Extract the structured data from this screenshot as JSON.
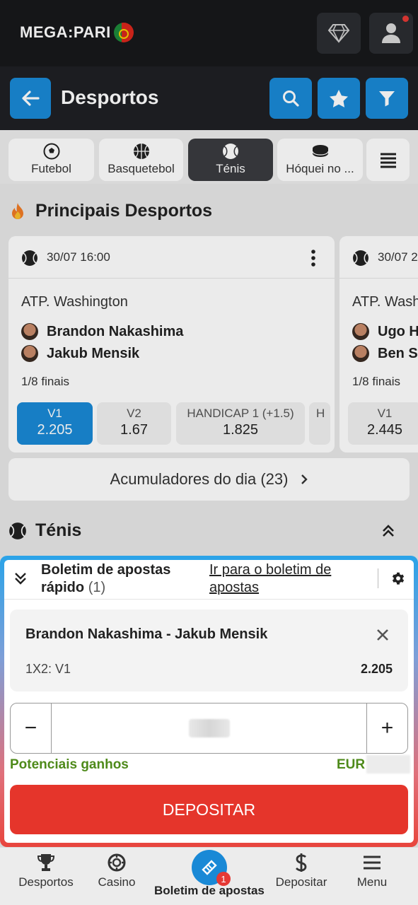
{
  "header": {
    "logo_text": "MEGA:PARI",
    "title": "Desportos"
  },
  "tabs": [
    {
      "label": "Futebol",
      "icon": "soccer-ball-icon",
      "active": false
    },
    {
      "label": "Basquetebol",
      "icon": "basketball-icon",
      "active": false
    },
    {
      "label": "Ténis",
      "icon": "tennis-ball-icon",
      "active": true
    },
    {
      "label": "Hóquei no ...",
      "icon": "hockey-puck-icon",
      "active": false
    }
  ],
  "main": {
    "top_section_title": "Principais Desportos",
    "cards": [
      {
        "datetime": "30/07 16:00",
        "league": "ATP. Washington",
        "player1": "Brandon Nakashima",
        "player2": "Jakub Mensik",
        "stage": "1/8 finais",
        "odds": [
          {
            "name": "V1",
            "value": "2.205",
            "selected": true
          },
          {
            "name": "V2",
            "value": "1.67"
          },
          {
            "name": "HANDICAP 1 (+1.5)",
            "value": "1.825"
          },
          {
            "name": "H",
            "value": ""
          }
        ]
      },
      {
        "datetime": "30/07 2",
        "league": "ATP. Wash",
        "player1": "Ugo H",
        "player2": "Ben Sh",
        "stage": "1/8 finais",
        "odds": [
          {
            "name": "V1",
            "value": "2.445"
          }
        ]
      }
    ],
    "accumulators": "Acumuladores do dia (23)",
    "tennis_section_title": "Ténis"
  },
  "slip": {
    "title_line1": "Boletim de apostas",
    "title_line2": "rápido",
    "count": "(1)",
    "link_line1": "Ir para o boletim de",
    "link_line2": "apostas",
    "match": "Brandon Nakashima - Jakub Mensik",
    "bet_type": "1X2: V1",
    "odd": "2.205",
    "minus": "−",
    "plus": "+",
    "gains_label": "Potenciais ganhos",
    "currency": "EUR",
    "deposit_label": "DEPOSITAR"
  },
  "bottom_nav": {
    "sports": "Desportos",
    "casino": "Casino",
    "betslip": "Boletim de apostas",
    "betslip_badge": "1",
    "deposit": "Depositar",
    "menu": "Menu"
  },
  "colors": {
    "accent": "#1989d6",
    "deposit": "#e5352b",
    "gains": "#4e8a1a"
  }
}
